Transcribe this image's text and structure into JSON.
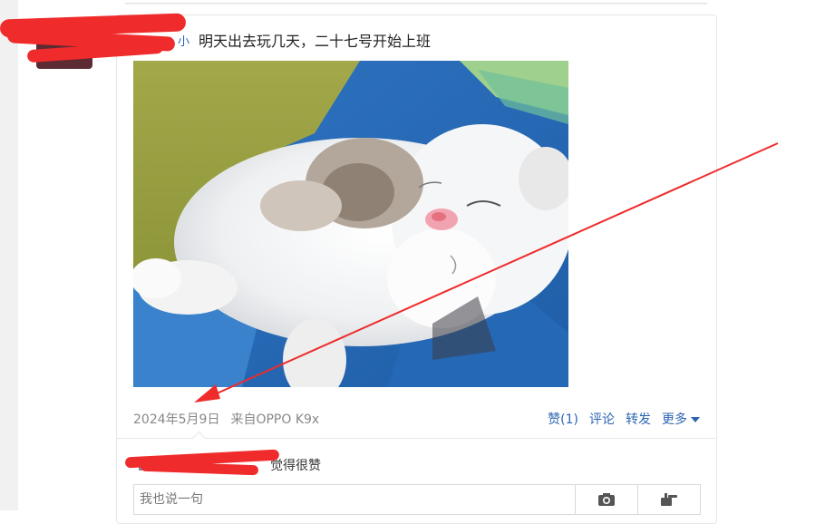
{
  "post": {
    "author_name_tail": "小",
    "text": "明天出去玩几天，二十七号开始上班",
    "image_alt": "熟睡的白色小猫",
    "date": "2024年5月9日",
    "source": "来自OPPO K9x"
  },
  "actions": {
    "like": "赞(1)",
    "comment": "评论",
    "repost": "转发",
    "more": "更多"
  },
  "likes": {
    "suffix": "觉得很赞"
  },
  "comment_box": {
    "placeholder": "我也说一句"
  },
  "colors": {
    "link": "#2d64b3",
    "annotation": "#ef2b2b"
  },
  "icons": [
    "camera-icon",
    "hand-icon",
    "caret-down-icon",
    "like-hand-icon"
  ]
}
